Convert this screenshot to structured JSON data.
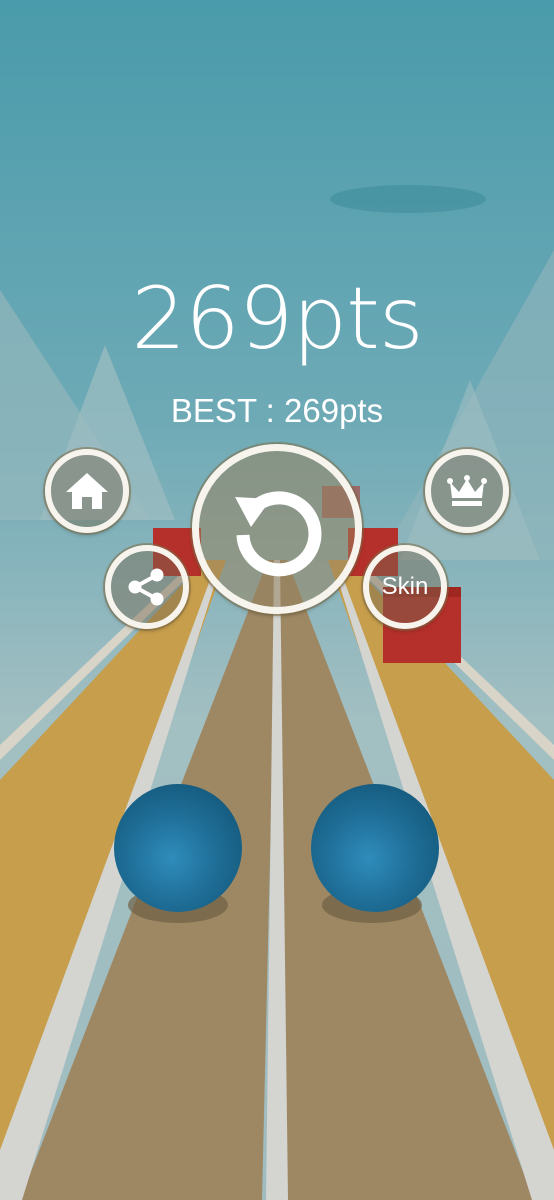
{
  "game": {
    "score_text": "269pts",
    "best_text": "BEST : 269pts"
  },
  "buttons": {
    "home_icon": "home-icon",
    "share_icon": "share-icon",
    "replay_icon": "replay-icon",
    "leaderboard_icon": "crown-icon",
    "skin_label": "Skin"
  },
  "colors": {
    "sky_top": "#4a9bab",
    "sky_bottom": "#a2bfc2",
    "lane_center": "#9e8864",
    "lane_side": "#c79e4c",
    "rail": "#d4d4d0",
    "ball": "#1d6b93",
    "obstacle": "#b5302a",
    "button_border": "#f7f4ee"
  }
}
